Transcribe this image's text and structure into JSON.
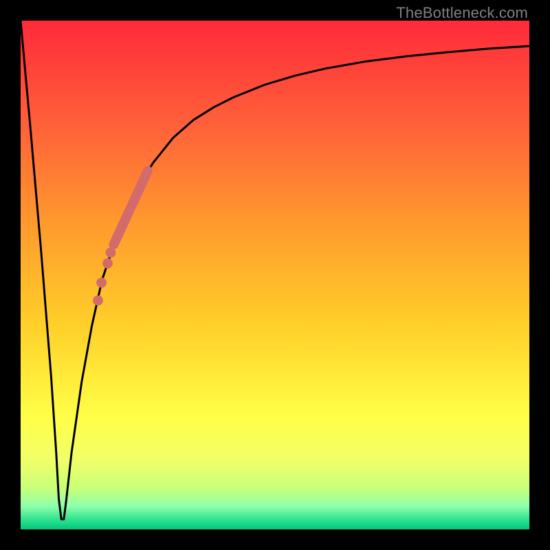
{
  "watermark": "TheBottleneck.com",
  "colors": {
    "frame": "#000000",
    "curve_stroke": "#000000",
    "dot_fill": "#d36b6b",
    "gradient_stops": [
      {
        "offset": 0.0,
        "color": "#ff2a3a"
      },
      {
        "offset": 0.2,
        "color": "#ff5f3a"
      },
      {
        "offset": 0.4,
        "color": "#ff9a2d"
      },
      {
        "offset": 0.6,
        "color": "#ffd029"
      },
      {
        "offset": 0.78,
        "color": "#ffff47"
      },
      {
        "offset": 0.86,
        "color": "#f3ff66"
      },
      {
        "offset": 0.92,
        "color": "#c7ff7a"
      },
      {
        "offset": 0.955,
        "color": "#8dffad"
      },
      {
        "offset": 0.98,
        "color": "#31e38f"
      },
      {
        "offset": 1.0,
        "color": "#00c77c"
      }
    ]
  },
  "chart_data": {
    "type": "line",
    "title": "",
    "xlabel": "",
    "ylabel": "",
    "xlim": [
      0,
      100
    ],
    "ylim": [
      0,
      100
    ],
    "grid": false,
    "series": [
      {
        "name": "bottleneck-curve",
        "x": [
          0,
          2,
          4,
          6,
          7,
          7.5,
          8,
          8.5,
          9,
          10,
          12,
          14,
          16,
          18,
          20,
          23,
          26,
          30,
          34,
          38,
          42,
          48,
          54,
          60,
          68,
          76,
          84,
          92,
          100
        ],
        "y": [
          100,
          78,
          55,
          30,
          15,
          6,
          2,
          2,
          6,
          15,
          29,
          40,
          49,
          55,
          61,
          67,
          72,
          77,
          80.5,
          83,
          85,
          87.4,
          89.2,
          90.6,
          92,
          93,
          93.8,
          94.5,
          95
        ]
      }
    ],
    "points": [
      {
        "name": "cluster-stroke",
        "type": "segment",
        "x": [
          18.3,
          25.0
        ],
        "y": [
          56.0,
          70.5
        ],
        "width": 2.2
      },
      {
        "name": "dot-1",
        "x": 15.2,
        "y": 45.0,
        "r": 1.0
      },
      {
        "name": "dot-2",
        "x": 15.9,
        "y": 48.5,
        "r": 1.0
      },
      {
        "name": "dot-3",
        "x": 17.1,
        "y": 52.3,
        "r": 1.0
      },
      {
        "name": "dot-4",
        "x": 17.7,
        "y": 54.4,
        "r": 1.0
      }
    ]
  }
}
